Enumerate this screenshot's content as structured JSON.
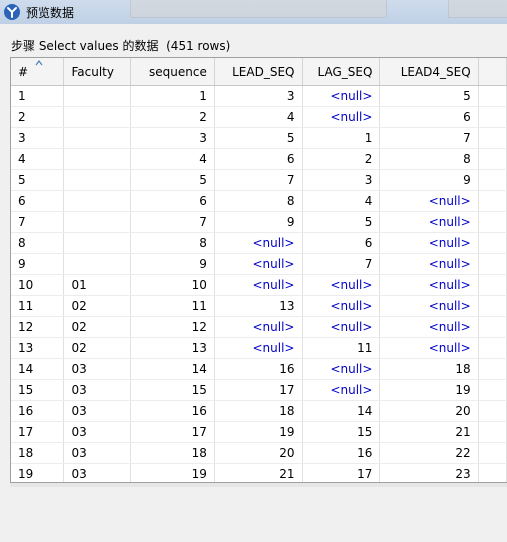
{
  "window": {
    "title": "预览数据"
  },
  "caption": "步骤 Select values 的数据  (451 rows)",
  "colors": {
    "null_text": "#0000c8"
  },
  "table": {
    "columns": [
      "#",
      "Faculty",
      "sequence",
      "LEAD_SEQ",
      "LAG_SEQ",
      "LEAD4_SEQ"
    ],
    "rows": [
      [
        "1",
        "",
        "1",
        "3",
        "<null>",
        "5"
      ],
      [
        "2",
        "",
        "2",
        "4",
        "<null>",
        "6"
      ],
      [
        "3",
        "",
        "3",
        "5",
        "1",
        "7"
      ],
      [
        "4",
        "",
        "4",
        "6",
        "2",
        "8"
      ],
      [
        "5",
        "",
        "5",
        "7",
        "3",
        "9"
      ],
      [
        "6",
        "",
        "6",
        "8",
        "4",
        "<null>"
      ],
      [
        "7",
        "",
        "7",
        "9",
        "5",
        "<null>"
      ],
      [
        "8",
        "",
        "8",
        "<null>",
        "6",
        "<null>"
      ],
      [
        "9",
        "",
        "9",
        "<null>",
        "7",
        "<null>"
      ],
      [
        "10",
        "01",
        "10",
        "<null>",
        "<null>",
        "<null>"
      ],
      [
        "11",
        "02",
        "11",
        "13",
        "<null>",
        "<null>"
      ],
      [
        "12",
        "02",
        "12",
        "<null>",
        "<null>",
        "<null>"
      ],
      [
        "13",
        "02",
        "13",
        "<null>",
        "11",
        "<null>"
      ],
      [
        "14",
        "03",
        "14",
        "16",
        "<null>",
        "18"
      ],
      [
        "15",
        "03",
        "15",
        "17",
        "<null>",
        "19"
      ],
      [
        "16",
        "03",
        "16",
        "18",
        "14",
        "20"
      ],
      [
        "17",
        "03",
        "17",
        "19",
        "15",
        "21"
      ],
      [
        "18",
        "03",
        "18",
        "20",
        "16",
        "22"
      ],
      [
        "19",
        "03",
        "19",
        "21",
        "17",
        "23"
      ]
    ]
  }
}
